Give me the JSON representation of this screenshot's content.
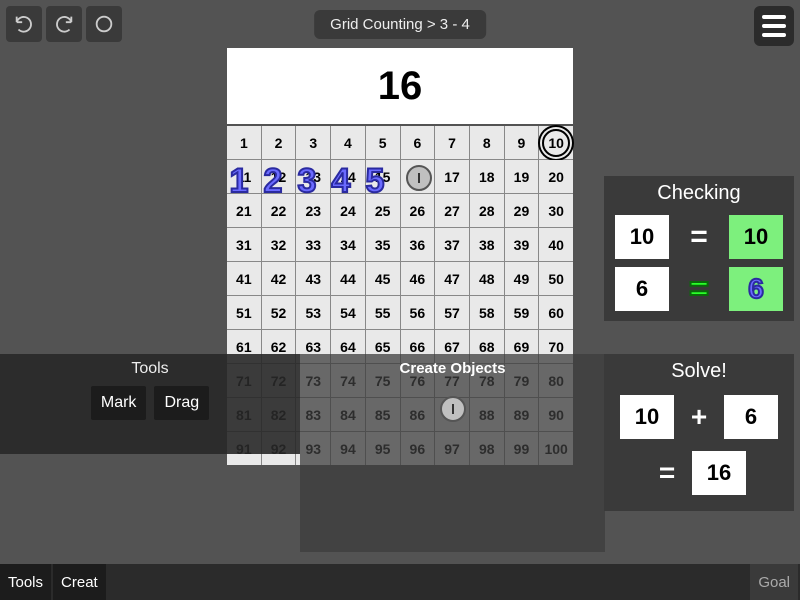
{
  "breadcrumb": "Grid Counting > 3 - 4",
  "big_number": "16",
  "grid": {
    "rows": 10,
    "cols": 10,
    "start": 1,
    "circled": [
      10
    ]
  },
  "overlay_digits": [
    "1",
    "2",
    "3",
    "4",
    "5"
  ],
  "tools": {
    "title": "Tools",
    "buttons": [
      "Mark",
      "Drag"
    ]
  },
  "create": {
    "title": "Create Objects"
  },
  "checking": {
    "title": "Checking",
    "rows": [
      {
        "left": "10",
        "op": "=",
        "right": "10",
        "style": "plain"
      },
      {
        "left": "6",
        "op": "=",
        "right": "6",
        "style": "green"
      }
    ]
  },
  "solve": {
    "title": "Solve!",
    "line1": {
      "a": "10",
      "op": "+",
      "b": "6"
    },
    "line2": {
      "op": "=",
      "r": "16"
    }
  },
  "bottom": {
    "left": [
      "Tools",
      "Creat"
    ],
    "right": [
      "Goal"
    ]
  }
}
